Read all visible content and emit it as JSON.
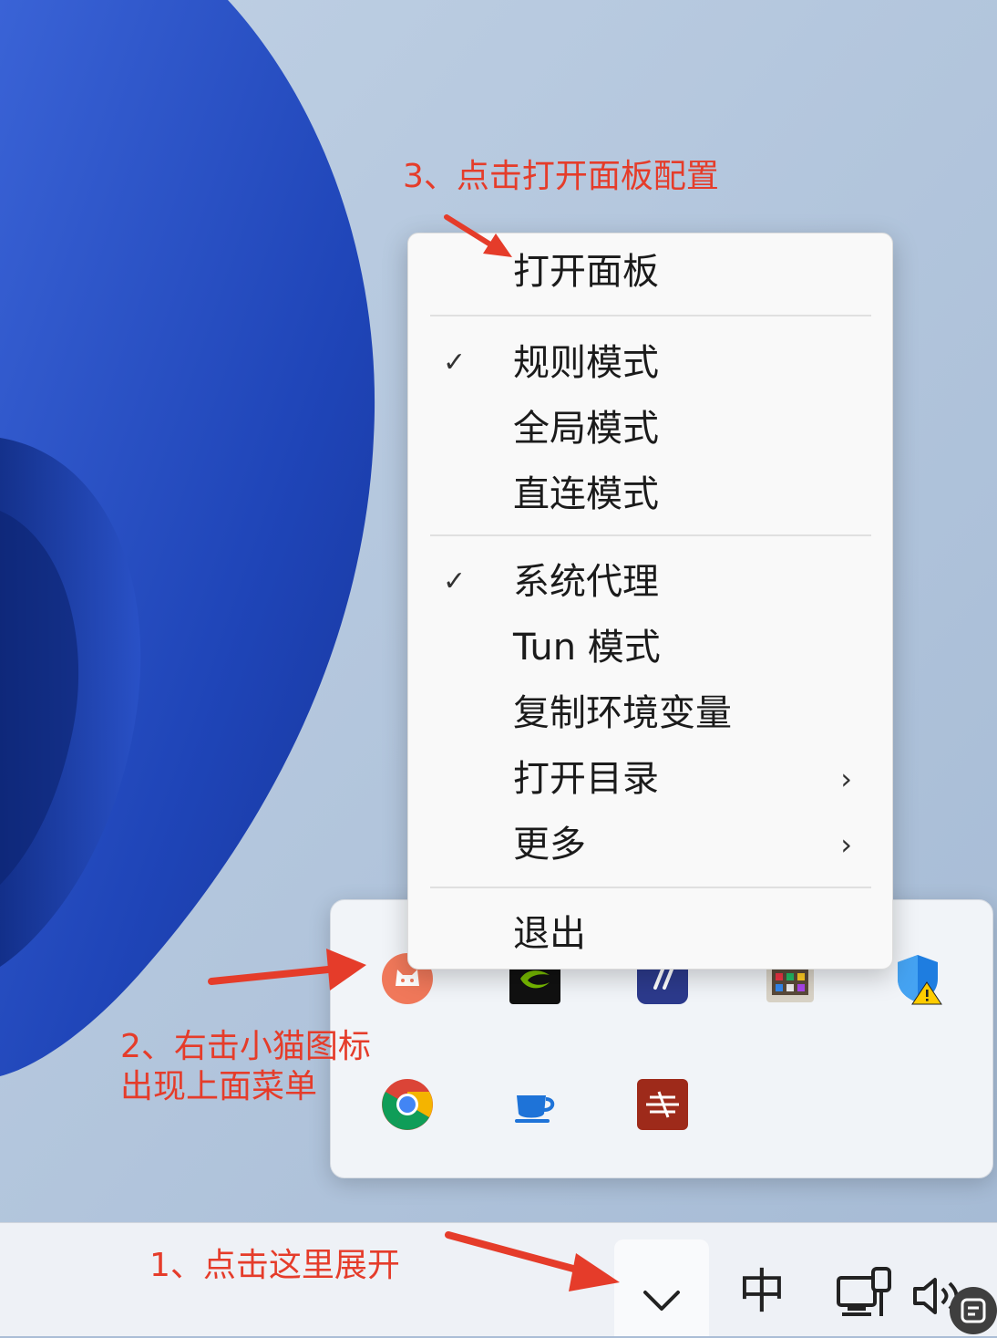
{
  "context_menu": {
    "items": [
      {
        "label": "打开面板",
        "checked": false,
        "submenu": false
      },
      {
        "label": "规则模式",
        "checked": true,
        "submenu": false
      },
      {
        "label": "全局模式",
        "checked": false,
        "submenu": false
      },
      {
        "label": "直连模式",
        "checked": false,
        "submenu": false
      },
      {
        "label": "系统代理",
        "checked": true,
        "submenu": false
      },
      {
        "label": "Tun 模式",
        "checked": false,
        "submenu": false
      },
      {
        "label": "复制环境变量",
        "checked": false,
        "submenu": false
      },
      {
        "label": "打开目录",
        "checked": false,
        "submenu": true
      },
      {
        "label": "更多",
        "checked": false,
        "submenu": true
      },
      {
        "label": "退出",
        "checked": false,
        "submenu": false
      }
    ],
    "check_glyph": "✓",
    "submenu_glyph": "›"
  },
  "tray_icons": [
    "clash-cat-icon",
    "nvidia-icon",
    "app-tile-icon",
    "app-grid-icon",
    "security-shield-warning-icon",
    "chrome-icon",
    "tea-cup-icon",
    "red-app-icon"
  ],
  "taskbar": {
    "ime_label": "中",
    "icons": [
      "chevron-up-icon",
      "network-icon",
      "volume-icon"
    ]
  },
  "annotations": {
    "step1": "1、点击这里展开",
    "step2": "2、右击小猫图标\n出现上面菜单",
    "step3": "3、点击打开面板配置"
  },
  "colors": {
    "annotation": "#e53c2a",
    "wallpaper_bg": "#aabdd6",
    "wallpaper_accent": "#1f45b8"
  }
}
